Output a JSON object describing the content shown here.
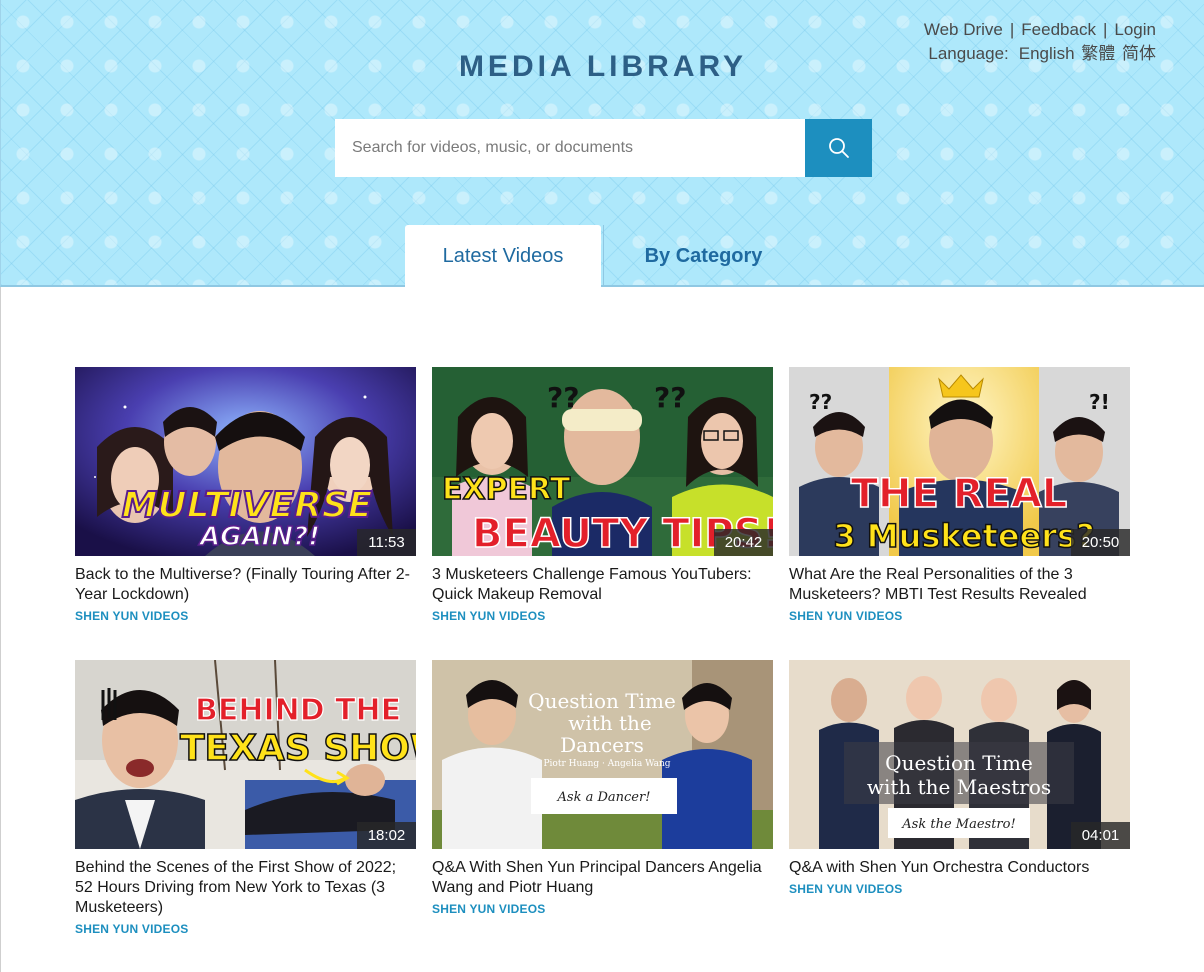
{
  "header": {
    "brand": "MEDIA LIBRARY",
    "nav": {
      "web_drive": "Web Drive",
      "sep1": "|",
      "feedback": "Feedback",
      "sep2": "|",
      "login": "Login",
      "language_label": "Language:",
      "languages": [
        "English",
        "繁體",
        "简体"
      ]
    },
    "search": {
      "placeholder": "Search for videos, music, or documents",
      "value": ""
    }
  },
  "tabs": [
    {
      "label": "Latest Videos",
      "active": true
    },
    {
      "label": "By Category",
      "active": false
    }
  ],
  "videos": [
    {
      "thumb_text": [
        "MULTIVERSE",
        "AGAIN?!"
      ],
      "duration": "11:53",
      "title": "Back to the Multiverse? (Finally Touring After 2-Year Lockdown)",
      "channel": "SHEN YUN VIDEOS"
    },
    {
      "thumb_text": [
        "EXPERT",
        "BEAUTY TIPS!"
      ],
      "duration": "20:42",
      "title": "3 Musketeers Challenge Famous YouTubers: Quick Makeup Removal",
      "channel": "SHEN YUN VIDEOS"
    },
    {
      "thumb_text": [
        "THE REAL",
        "3 Musketeers?"
      ],
      "duration": "20:50",
      "title": "What Are the Real Personalities of the 3 Musketeers? MBTI Test Results Revealed",
      "channel": "SHEN YUN VIDEOS"
    },
    {
      "thumb_text": [
        "BEHIND THE",
        "TEXAS SHOW"
      ],
      "duration": "18:02",
      "title": "Behind the Scenes of the First Show of 2022; 52 Hours Driving from New York to Texas (3 Musketeers)",
      "channel": "SHEN YUN VIDEOS"
    },
    {
      "thumb_text": [
        "Question Time",
        "with the",
        "Dancers",
        "Piotr Huang · Angelia Wang",
        "Ask a Dancer!"
      ],
      "duration": "",
      "title": "Q&A With Shen Yun Principal Dancers Angelia Wang and Piotr Huang",
      "channel": "SHEN YUN VIDEOS"
    },
    {
      "thumb_text": [
        "Question Time",
        "with the Maestros",
        "Ask the Maestro!"
      ],
      "duration": "04:01",
      "title": "Q&A with Shen Yun Orchestra Conductors",
      "channel": "SHEN YUN VIDEOS"
    }
  ],
  "colors": {
    "header_bg": "#aee8fb",
    "brand": "#2d5f86",
    "accent": "#1d8fbf",
    "tab_text": "#1f6aa0"
  }
}
